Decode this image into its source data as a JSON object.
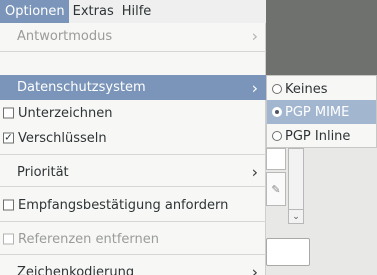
{
  "menubar": {
    "items": [
      {
        "label": "Optionen",
        "active": true
      },
      {
        "label": "Extras",
        "active": false
      },
      {
        "label": "Hilfe",
        "active": false
      }
    ]
  },
  "menu": {
    "antwortmodus": "Antwortmodus",
    "datenschutzsystem": "Datenschutzsystem",
    "unterzeichnen": "Unterzeichnen",
    "verschluesseln": "Verschlüsseln",
    "prioritaet": "Priorität",
    "empfangsbestaetigung": "Empfangsbestätigung anfordern",
    "referenzen": "Referenzen entfernen",
    "zeichenkodierung": "Zeichenkodierung",
    "check_mark": "✓"
  },
  "submenu": {
    "items": [
      {
        "label": "Keines",
        "selected": false,
        "highlighted": false
      },
      {
        "label": "PGP MIME",
        "selected": true,
        "highlighted": true
      },
      {
        "label": "PGP Inline",
        "selected": false,
        "highlighted": false
      }
    ]
  },
  "icons": {
    "chevron": "chevron-right-icon",
    "checkbox": "checkbox-icon",
    "radio": "radio-icon"
  },
  "colors": {
    "highlight": "#7a95b9",
    "submenu_highlight": "#a3b6cf",
    "menu_bg": "#f7f7f6",
    "disabled_text": "#9a9c99"
  }
}
